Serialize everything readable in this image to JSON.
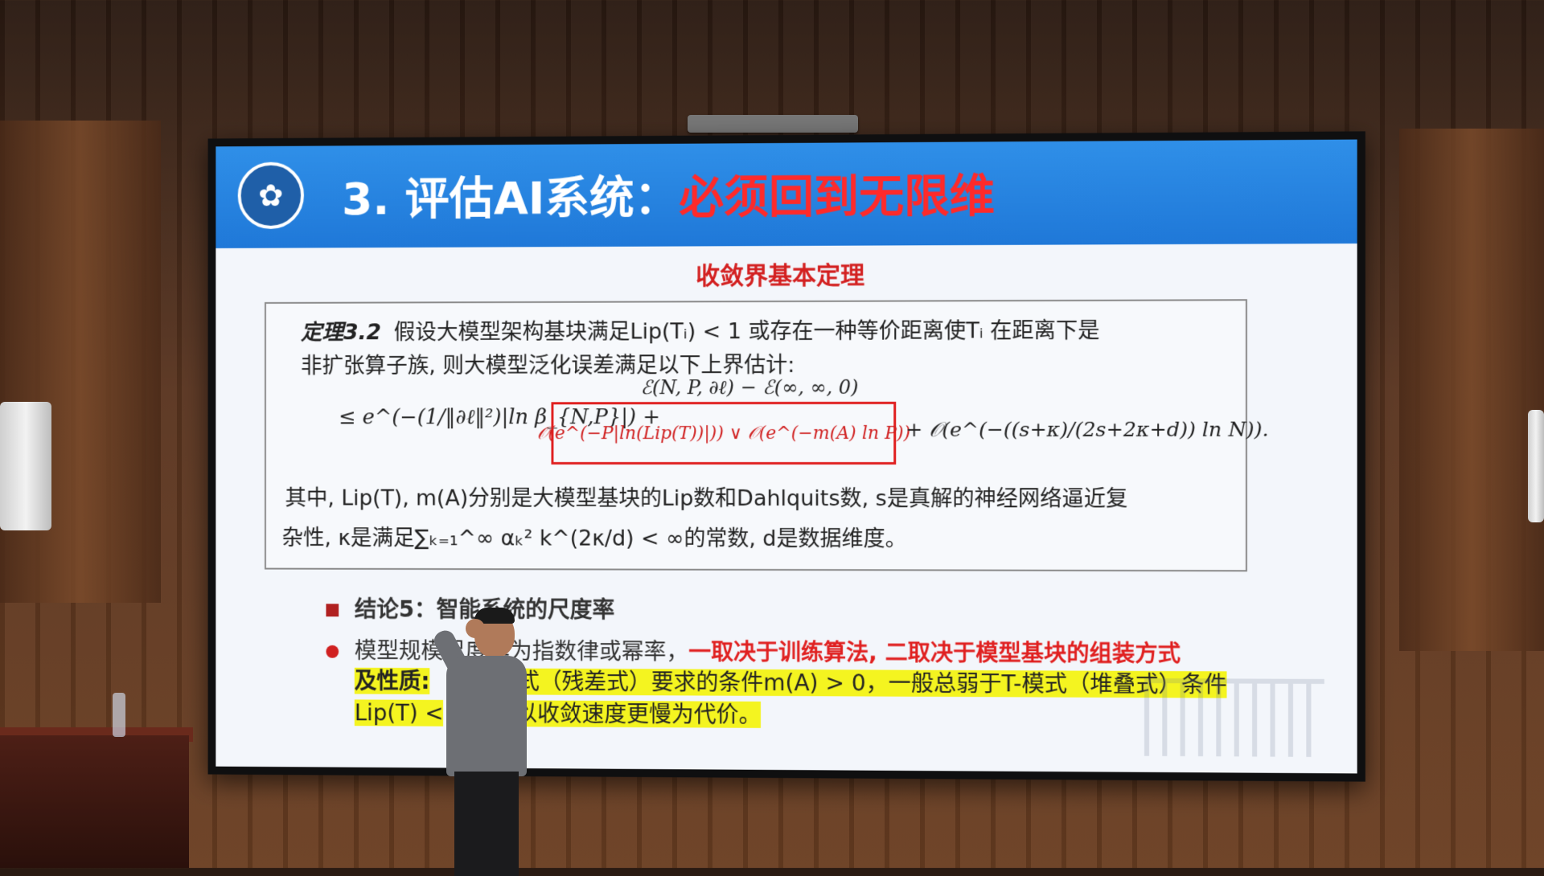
{
  "slide": {
    "title_main": "3. 评估AI系统：",
    "title_highlight": "必须回到无限维",
    "subtitle": "收敛界基本定理",
    "theorem": {
      "label": "定理3.2",
      "line1": "假设大模型架构基块满足Lip(Tᵢ) < 1 或存在一种等价距离使Tᵢ 在距离下是",
      "line2": "非扩张算子族, 则大模型泛化误差满足以下上界估计:",
      "formula_top": "ℰ(N, P, ∂ℓ) − ℰ(∞, ∞, 0)",
      "formula_left": "≤ e^(−(1/‖∂ℓ‖²)|ln β_{N,P}|) +",
      "formula_boxed": "𝒪(e^(−P|ln(Lip(T))|)) ∨ 𝒪(e^(−m(A) ln P))",
      "formula_right": "+ 𝒪(e^(−((s+κ)/(2s+2κ+d)) ln N)).",
      "explain_line1": "其中, Lip(T), m(A)分别是大模型基块的Lip数和Dahlquits数, s是真解的神经网络逼近复",
      "explain_line2": "杂性, κ是满足∑ₖ₌₁^∞ αₖ² k^(2κ/d) < ∞的常数, d是数据维度。"
    },
    "conclusion": "结论5：智能系统的尺度率",
    "bullet_prefix": "模型规模尺度率为指数律或幂率，",
    "bullet_red_1": "一取决于训练算法, 二取决于模型基块的组装方式",
    "bullet_red_2": "及性质:",
    "bullet_highlight_1": "式（残差式）要求的条件m(A) > 0，一般总弱于T-模式（堆叠式）条件",
    "bullet_highlight_2": "Lip(T) <",
    "bullet_highlight_3": "以收敛速度更慢为代价。"
  },
  "colors": {
    "header_blue": "#1f78d8",
    "title_red": "#ff2a2a",
    "highlight_yellow": "#f4f420",
    "box_red": "#e02020"
  },
  "icons": {
    "logo": "university-seal-icon",
    "square_bullet": "square-bullet-icon",
    "dot_bullet": "dot-bullet-icon"
  }
}
